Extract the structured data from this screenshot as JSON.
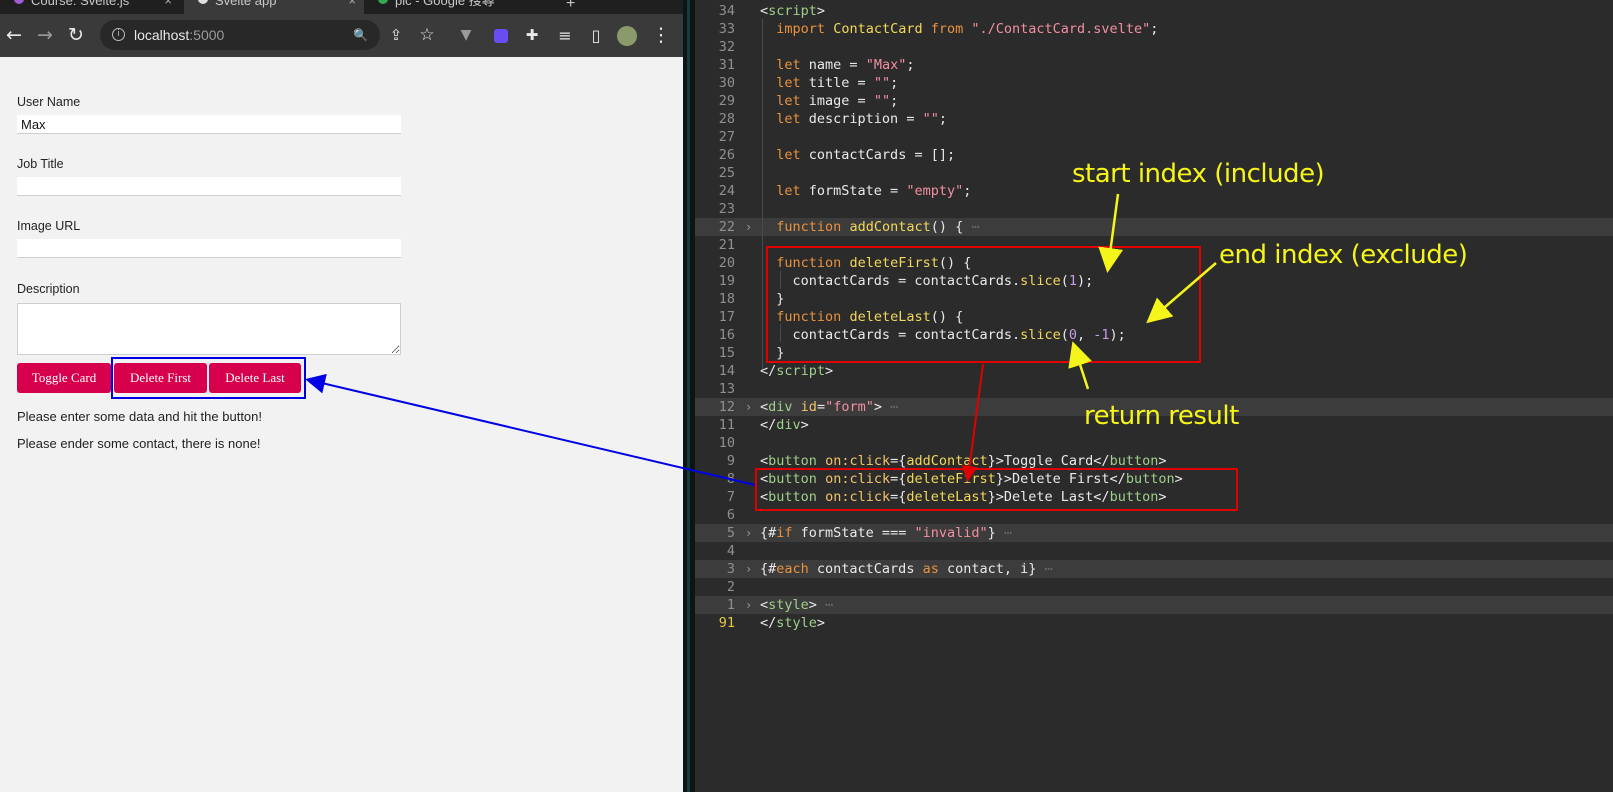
{
  "browser": {
    "tabs": [
      {
        "label": "Course: Svelte.js",
        "fav_color": "#a05bd6",
        "active": false
      },
      {
        "label": "Svelte app",
        "fav_color": "#e0e0e0",
        "active": true
      },
      {
        "label": "pic - Google 搜尋",
        "fav_color": "#34a853",
        "active": false
      }
    ],
    "new_tab_symbol": "+",
    "close_symbol": "×",
    "toolbar": {
      "back": "←",
      "forward": "→",
      "reload": "↻",
      "host": "localhost",
      "port": ":5000",
      "info_symbol": "i",
      "zoom": "🔍",
      "share": "⇪",
      "star": "☆",
      "ext1": "▼",
      "ext2": "◆",
      "puzzle": "✚",
      "media": "≡",
      "sidebar": "▯",
      "menu": "⋮"
    }
  },
  "form": {
    "username_label": "User Name",
    "username_value": "Max",
    "jobtitle_label": "Job Title",
    "jobtitle_value": "",
    "imageurl_label": "Image URL",
    "imageurl_value": "",
    "description_label": "Description",
    "description_value": "",
    "toggle_label": "Toggle Card",
    "delete_first_label": "Delete First",
    "delete_last_label": "Delete Last",
    "message1": "Please enter some data and hit the button!",
    "message2": "Please ender some contact, there is none!"
  },
  "editor": {
    "current_line": "91",
    "annotations": {
      "start": "start index (include)",
      "end": "end index (exclude)",
      "result": "return result"
    },
    "lines": [
      {
        "n": "34",
        "html": "&lt;<span class=\"t\">script</span>&gt;"
      },
      {
        "n": "33",
        "html": "  <span class=\"k\">import</span> <span class=\"f\">ContactCard</span> <span class=\"k\">from</span> <span class=\"s\">\"./ContactCard.svelte\"</span>;"
      },
      {
        "n": "32",
        "html": ""
      },
      {
        "n": "31",
        "html": "  <span class=\"k\">let</span> name = <span class=\"s\">\"Max\"</span>;"
      },
      {
        "n": "30",
        "html": "  <span class=\"k\">let</span> title = <span class=\"s\">\"\"</span>;"
      },
      {
        "n": "29",
        "html": "  <span class=\"k\">let</span> image = <span class=\"s\">\"\"</span>;"
      },
      {
        "n": "28",
        "html": "  <span class=\"k\">let</span> description = <span class=\"s\">\"\"</span>;"
      },
      {
        "n": "27",
        "html": ""
      },
      {
        "n": "26",
        "html": "  <span class=\"k\">let</span> contactCards = [];"
      },
      {
        "n": "25",
        "html": ""
      },
      {
        "n": "24",
        "html": "  <span class=\"k\">let</span> formState = <span class=\"s\">\"empty\"</span>;"
      },
      {
        "n": "23",
        "html": ""
      },
      {
        "n": "22",
        "html": "  <span class=\"k\">function</span> <span class=\"f\">addContact</span>() { <span class=\"gl\">⋯</span>",
        "fold": true
      },
      {
        "n": "21",
        "html": ""
      },
      {
        "n": "20",
        "html": "  <span class=\"k\">function</span> <span class=\"f\">deleteFirst</span>() {"
      },
      {
        "n": "19",
        "html": "    contactCards = contactCards.<span class=\"f\">slice</span>(<span class=\"p\">1</span>);"
      },
      {
        "n": "18",
        "html": "  }"
      },
      {
        "n": "17",
        "html": "  <span class=\"k\">function</span> <span class=\"f\">deleteLast</span>() {"
      },
      {
        "n": "16",
        "html": "    contactCards = contactCards.<span class=\"f\">slice</span>(<span class=\"p\">0</span>, <span class=\"p\">-1</span>);"
      },
      {
        "n": "15",
        "html": "  }"
      },
      {
        "n": "14",
        "html": "&lt;/<span class=\"t\">script</span>&gt;"
      },
      {
        "n": "13",
        "html": ""
      },
      {
        "n": "12",
        "html": "&lt;<span class=\"t\">div</span> <span class=\"a\">id</span>=<span class=\"s\">\"form\"</span>&gt; <span class=\"gl\">⋯</span>",
        "fold": true
      },
      {
        "n": "11",
        "html": "&lt;/<span class=\"t\">div</span>&gt;"
      },
      {
        "n": "10",
        "html": ""
      },
      {
        "n": "9",
        "html": "&lt;<span class=\"t\">button</span> <span class=\"a\">on:click</span>={<span class=\"f\">addContact</span>}&gt;Toggle Card&lt;/<span class=\"t\">button</span>&gt;"
      },
      {
        "n": "8",
        "html": "&lt;<span class=\"t\">button</span> <span class=\"a\">on:click</span>={<span class=\"f\">deleteFirst</span>}&gt;Delete First&lt;/<span class=\"t\">button</span>&gt;"
      },
      {
        "n": "7",
        "html": "&lt;<span class=\"t\">button</span> <span class=\"a\">on:click</span>={<span class=\"f\">deleteLast</span>}&gt;Delete Last&lt;/<span class=\"t\">button</span>&gt;"
      },
      {
        "n": "6",
        "html": ""
      },
      {
        "n": "5",
        "html": "{#<span class=\"k\">if</span> formState === <span class=\"s\">\"invalid\"</span>} <span class=\"gl\">⋯</span>",
        "fold": true
      },
      {
        "n": "4",
        "html": ""
      },
      {
        "n": "3",
        "html": "{#<span class=\"k\">each</span> contactCards <span class=\"k\">as</span> contact, i} <span class=\"gl\">⋯</span>",
        "fold": true
      },
      {
        "n": "2",
        "html": ""
      },
      {
        "n": "1",
        "html": "&lt;<span class=\"t\">style</span>&gt; <span class=\"gl\">⋯</span>",
        "fold": true
      },
      {
        "n": "91",
        "html": "&lt;/<span class=\"t\">style</span>&gt;",
        "current": true
      }
    ]
  },
  "colors": {
    "accent_button": "#d6004c",
    "highlight_blue": "#0000e6",
    "highlight_red": "#e00000",
    "annotation_yellow": "#f5f51a"
  }
}
